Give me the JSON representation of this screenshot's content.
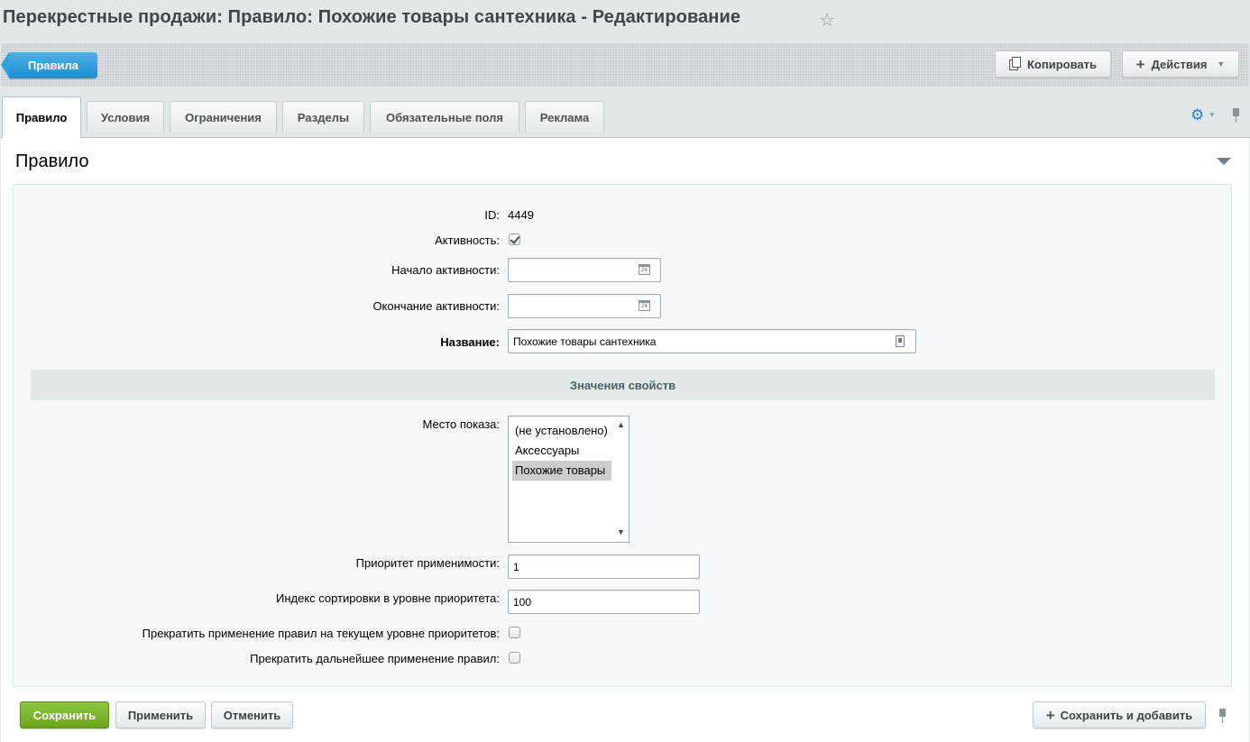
{
  "page": {
    "title": "Перекрестные продажи: Правило: Похожие товары сантехника - Редактирование",
    "favorite_icon": "star-icon"
  },
  "toolbar": {
    "back_label": "Правила",
    "copy_label": "Копировать",
    "actions_label": "Действия"
  },
  "tabs": [
    {
      "label": "Правило",
      "active": true
    },
    {
      "label": "Условия",
      "active": false
    },
    {
      "label": "Ограничения",
      "active": false
    },
    {
      "label": "Разделы",
      "active": false
    },
    {
      "label": "Обязательные поля",
      "active": false
    },
    {
      "label": "Реклама",
      "active": false
    }
  ],
  "section": {
    "title": "Правило"
  },
  "form": {
    "id_label": "ID:",
    "id_value": "4449",
    "active_label": "Активность:",
    "active_checked": true,
    "start_label": "Начало активности:",
    "start_value": "",
    "end_label": "Окончание активности:",
    "end_value": "",
    "name_label": "Название:",
    "name_value": "Похожие товары сантехника"
  },
  "properties": {
    "header": "Значения свойств",
    "place_label": "Место показа:",
    "place_options": [
      {
        "label": "(не установлено)",
        "selected": false
      },
      {
        "label": "Аксессуары",
        "selected": false
      },
      {
        "label": "Похожие товары",
        "selected": true
      }
    ],
    "priority_label": "Приоритет применимости:",
    "priority_value": "1",
    "sort_label": "Индекс сортировки в уровне приоритета:",
    "sort_value": "100",
    "stop_level_label": "Прекратить применение правил на текущем уровне приоритетов:",
    "stop_level_checked": false,
    "stop_all_label": "Прекратить дальнейшее применение правил:",
    "stop_all_checked": false
  },
  "buttons": {
    "save": "Сохранить",
    "apply": "Применить",
    "cancel": "Отменить",
    "save_add": "Сохранить и добавить"
  },
  "colors": {
    "back_button": "#1f8ed0",
    "save_button": "#7ab52a",
    "page_background": "#e1e8ea"
  }
}
